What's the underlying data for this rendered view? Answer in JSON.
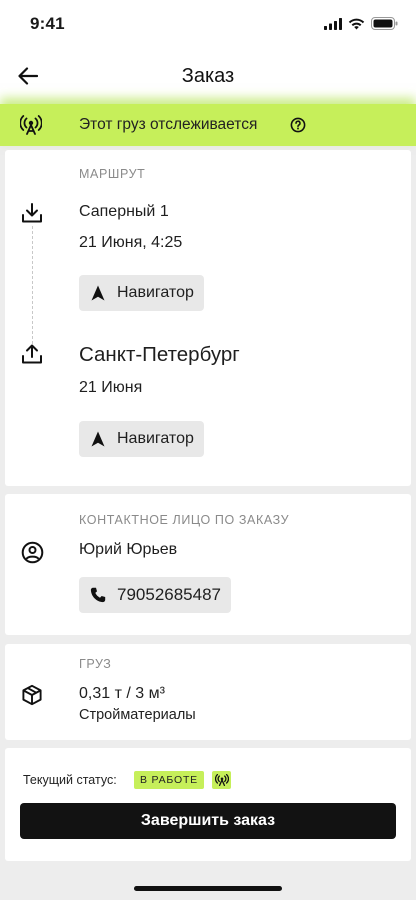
{
  "status_bar": {
    "time": "9:41"
  },
  "header": {
    "title": "Заказ"
  },
  "tracking_banner": {
    "text": "Этот груз отслеживается"
  },
  "route": {
    "section_label": "МАРШРУТ",
    "from": {
      "address": "Саперный 1",
      "datetime": "21 Июня, 4:25",
      "navigator_label": "Навигатор"
    },
    "to": {
      "address": "Санкт-Петербург",
      "datetime": "21 Июня",
      "navigator_label": "Навигатор"
    }
  },
  "contact": {
    "section_label": "КОНТАКТНОЕ ЛИЦО ПО ЗАКАЗУ",
    "name": "Юрий Юрьев",
    "phone": "79052685487"
  },
  "cargo": {
    "section_label": "ГРУЗ",
    "weight_volume": "0,31 т / 3 м³",
    "type": "Стройматериалы"
  },
  "order_status": {
    "label": "Текущий статус:",
    "badge": "В РАБОТЕ",
    "finish_button": "Завершить заказ"
  },
  "colors": {
    "accent": "#c6ef5a",
    "button": "#121212",
    "background": "#ededed"
  },
  "icons": {
    "back": "arrow-left-icon",
    "tracking": "radio-tower-icon",
    "help": "question-circle-icon",
    "pickup": "download-icon",
    "dropoff": "upload-icon",
    "navigator": "navigation-arrow-icon",
    "contact": "user-circle-icon",
    "phone": "phone-icon",
    "cargo": "package-icon"
  }
}
